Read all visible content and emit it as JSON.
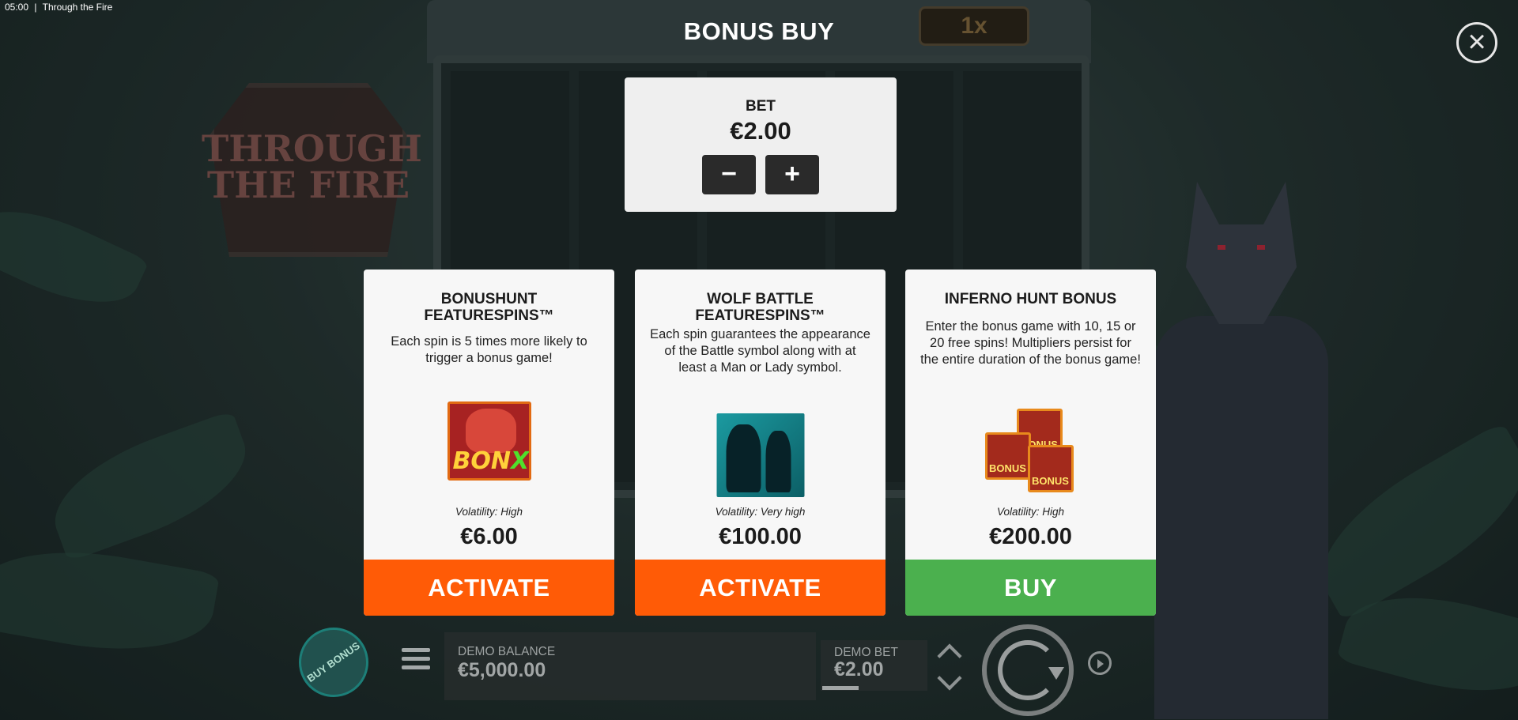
{
  "status_bar": {
    "time": "05:00",
    "separator": "|",
    "title": "Through the Fire"
  },
  "game": {
    "logo_text": "THROUGH THE FIRE",
    "multiplier": "1x"
  },
  "bonus_buy": {
    "title": "BONUS BUY",
    "close_icon": "close-icon",
    "bet": {
      "label": "BET",
      "value": "€2.00",
      "decrease_label": "−",
      "increase_label": "+"
    },
    "cards": [
      {
        "title": "BONUSHUNT FEATURESPINS™",
        "description": "Each spin is 5 times more likely to trigger a bonus game!",
        "image_text_a": "BON",
        "image_text_b": "XS",
        "volatility": "Volatility: High",
        "price": "€6.00",
        "action": "ACTIVATE",
        "action_color": "#ff5b06"
      },
      {
        "title": "WOLF BATTLE FEATURESPINS™",
        "description": "Each spin guarantees the appearance of the Battle symbol along with at least a Man or Lady symbol.",
        "volatility": "Volatility: Very high",
        "price": "€100.00",
        "action": "ACTIVATE",
        "action_color": "#ff5b06"
      },
      {
        "title": "INFERNO HUNT BONUS",
        "description": "Enter the bonus game with 10, 15 or 20 free spins! Multipliers persist for the entire duration of the bonus game!",
        "image_chip_text": "BONUS",
        "volatility": "Volatility: High",
        "price": "€200.00",
        "action": "BUY",
        "action_color": "#4bb04e"
      }
    ]
  },
  "bottom_bar": {
    "buy_bonus_label": "BUY BONUS",
    "balance_label": "DEMO BALANCE",
    "balance_value": "€5,000.00",
    "bet_label": "DEMO BET",
    "bet_value": "€2.00",
    "icons": [
      "menu-icon",
      "bet-arrows-icon",
      "spin-icon",
      "autoplay-icon"
    ]
  }
}
